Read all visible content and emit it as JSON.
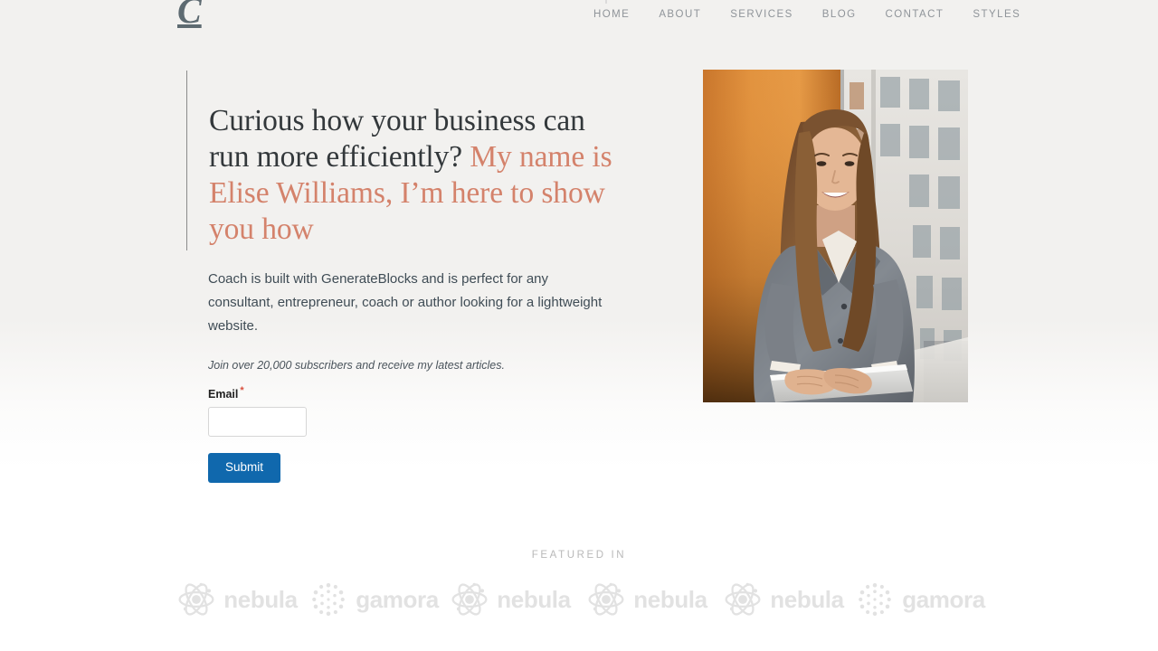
{
  "site": {
    "brand_logo_text": "C",
    "background_top_color": "#f2f1ef",
    "background_bottom_color": "#ffffff"
  },
  "nav": {
    "items": [
      {
        "label": "HOME",
        "icon": "none"
      },
      {
        "label": "ABOUT",
        "icon": "none"
      },
      {
        "label": "SERVICES",
        "icon": "none"
      },
      {
        "label": "BLOG",
        "icon": "none"
      },
      {
        "label": "CONTACT",
        "icon": "none"
      },
      {
        "label": "STYLES",
        "icon": "none"
      }
    ],
    "text_color": "#8f9499"
  },
  "hero": {
    "headline_part1": "Curious how your business can run more efficiently? ",
    "headline_part2": "My name is Elise Williams, I’m here to show you how",
    "headline_color": "#33383b",
    "accent_color": "#d4826b",
    "body": "Coach is built with GenerateBlocks and is perfect for any consultant, entrepreneur, coach or author looking for a lightweight website.",
    "note": "Join over 20,000 subscribers and receive my latest articles.",
    "image_alt": "Smiling woman in gray blazer holding a silver laptop, standing by a window with an orange wall behind her"
  },
  "form": {
    "email_label": "Email",
    "required_marker": "*",
    "email_value": "",
    "email_placeholder": "",
    "submit_label": "Submit",
    "submit_color": "#1068ad"
  },
  "featured": {
    "title": "FEATURED IN",
    "title_color": "#b9b9b9",
    "logos": [
      {
        "name": "nebula",
        "mark": "atom-icon"
      },
      {
        "name": "gamora",
        "mark": "dot-circle-icon"
      },
      {
        "name": "nebula",
        "mark": "atom-icon"
      },
      {
        "name": "nebula",
        "mark": "atom-icon"
      },
      {
        "name": "nebula",
        "mark": "atom-icon"
      },
      {
        "name": "gamora",
        "mark": "dot-circle-icon"
      }
    ],
    "logo_color": "#e2e2e2"
  }
}
